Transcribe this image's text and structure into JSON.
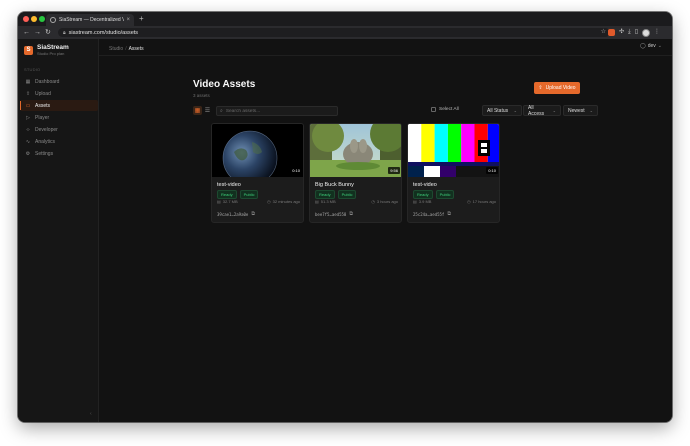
{
  "browser": {
    "tab_title": "SiaStream — Decentralized V",
    "tab_close": "×",
    "new_tab": "+",
    "url": "siastream.com/studio/assets",
    "back": "←",
    "forward": "→",
    "reload": "↻"
  },
  "brand": {
    "logo_letter": "S",
    "name": "SiaStream",
    "subtitle": "Studio Pro plan"
  },
  "sidebar": {
    "section_label": "STUDIO",
    "items": [
      {
        "label": "Dashboard",
        "icon": "grid-icon",
        "glyph": "▦",
        "active": false
      },
      {
        "label": "Upload",
        "icon": "upload-icon",
        "glyph": "⇧",
        "active": false
      },
      {
        "label": "Assets",
        "icon": "folder-icon",
        "glyph": "▭",
        "active": true
      },
      {
        "label": "Player",
        "icon": "play-icon",
        "glyph": "▷",
        "active": false
      },
      {
        "label": "Developer",
        "icon": "code-icon",
        "glyph": "‹›",
        "active": false
      },
      {
        "label": "Analytics",
        "icon": "chart-icon",
        "glyph": "∿",
        "active": false
      },
      {
        "label": "Settings",
        "icon": "gear-icon",
        "glyph": "⚙",
        "active": false
      }
    ],
    "collapse_glyph": "‹"
  },
  "header": {
    "breadcrumb_root": "Studio",
    "breadcrumb_sep": "/",
    "breadcrumb_current": "Assets",
    "user_label": "dev",
    "user_chevron": "⌄"
  },
  "page": {
    "title": "Video Assets",
    "count": "3 assets",
    "upload_label": "Upload Video",
    "upload_glyph": "⇧"
  },
  "filters": {
    "search_placeholder": "Search assets...",
    "select_all": "Select All",
    "status": "All Status",
    "access": "All Access",
    "sort": "Newest",
    "chevron": "⌄"
  },
  "assets": [
    {
      "title": "test-video",
      "status": "Ready",
      "access": "Public",
      "size": "32.7 MB",
      "time": "32 minutes ago",
      "id": "39cae1…2a9a0e",
      "duration": "0:10",
      "thumb": "earth"
    },
    {
      "title": "Big Buck Bunny",
      "status": "Ready",
      "access": "Public",
      "size": "51.3 MB",
      "time": "3 hours ago",
      "id": "bee7f5…aed558",
      "duration": "9:56",
      "thumb": "bunny"
    },
    {
      "title": "test-video",
      "status": "Ready",
      "access": "Public",
      "size": "3.9 MB",
      "time": "17 hours ago",
      "id": "25c24a…aed55f",
      "duration": "0:10",
      "thumb": "bars"
    }
  ],
  "colors": {
    "accent": "#e5692b",
    "badge_green": "#3ecf7a"
  }
}
